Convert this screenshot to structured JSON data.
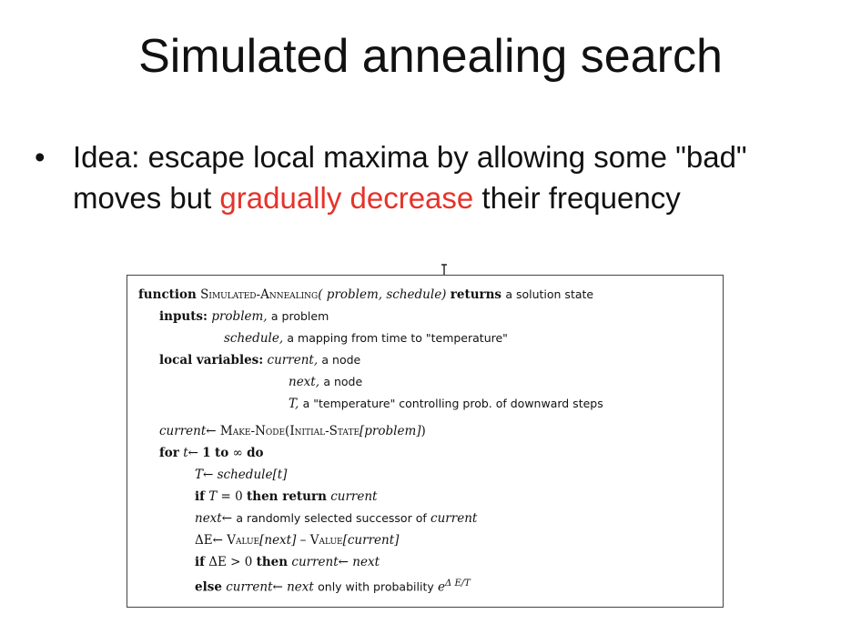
{
  "slide": {
    "title": "Simulated annealing search",
    "bullet_marker": "•",
    "bullet_pre": "Idea: escape local maxima by allowing some \"bad\" moves but ",
    "bullet_highlight": "gradually decrease",
    "bullet_post": " their frequency",
    "highlight_color": "#e5332a"
  },
  "algorithm": {
    "l1": {
      "kw1": "function",
      "name": "Simulated-Annealing",
      "params": "( problem, schedule)",
      "kw2": "returns",
      "rest": "a solution state"
    },
    "l2": {
      "label": "inputs:",
      "var": "problem,",
      "rest": "a problem"
    },
    "l3": {
      "var": "schedule,",
      "rest": "a mapping from time to \"temperature\""
    },
    "l4": {
      "label": "local variables:",
      "var": "current,",
      "rest": "a node"
    },
    "l5": {
      "var": "next,",
      "rest": "a node"
    },
    "l6": {
      "var": "T,",
      "rest": "a \"temperature\" controlling prob. of downward steps"
    },
    "l7": {
      "var": "current",
      "arrow": "←",
      "fn1": "Make-Node",
      "fn2": "(Initial-State",
      "arg": "[problem]",
      "close": ")"
    },
    "l8": {
      "kw": "for",
      "var": "t",
      "arrow": "←",
      "val": "1",
      "kw2": "to",
      "inf": "∞",
      "kw3": "do"
    },
    "l9": {
      "var": "T",
      "arrow": "←",
      "rhs": "schedule[t]"
    },
    "l10": {
      "kw": "if",
      "var": "T",
      "cond": "= 0",
      "kw2": "then return",
      "var2": "current"
    },
    "l11": {
      "var": "next",
      "arrow": "←",
      "rest": "a randomly selected successor of",
      "var2": "current"
    },
    "l12": {
      "lhs": "ΔE",
      "arrow": "←",
      "fn1": "Value",
      "arg1": "[next]",
      "minus": "–",
      "fn2": "Value",
      "arg2": "[current]"
    },
    "l13": {
      "kw": "if",
      "cond": "ΔE > 0",
      "kw2": "then",
      "var": "current",
      "arrow": "←",
      "var2": "next"
    },
    "l14": {
      "kw": "else",
      "var": "current",
      "arrow": "←",
      "var2": "next",
      "rest": "only with probability",
      "exp_base": "e",
      "exp": "Δ E/T"
    }
  }
}
